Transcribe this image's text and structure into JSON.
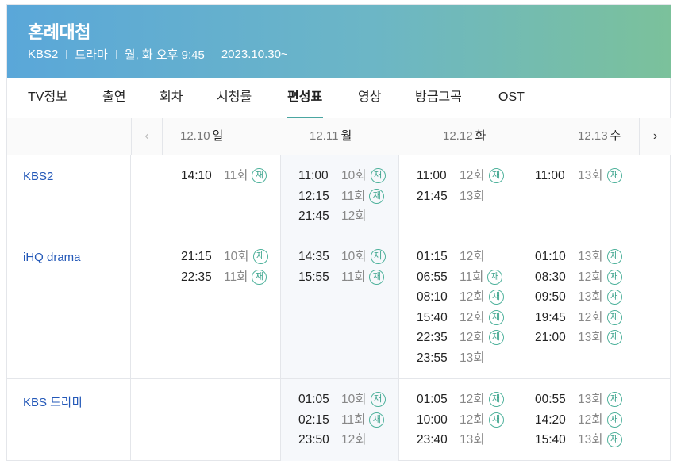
{
  "program": {
    "title": "혼례대첩",
    "channel": "KBS2",
    "genre": "드라마",
    "airtime": "월, 화 오후 9:45",
    "start_date": "2023.10.30~"
  },
  "tabs": [
    "TV정보",
    "출연",
    "회차",
    "시청률",
    "편성표",
    "영상",
    "방금그곡",
    "OST"
  ],
  "active_tab": "편성표",
  "nav": {
    "prev_icon": "‹",
    "next_icon": "›"
  },
  "days": [
    {
      "date": "12.10",
      "weekday": "일"
    },
    {
      "date": "12.11",
      "weekday": "월"
    },
    {
      "date": "12.12",
      "weekday": "화"
    },
    {
      "date": "12.13",
      "weekday": "수"
    }
  ],
  "rerun_mark": "재",
  "schedule": [
    {
      "channel": "KBS2",
      "days": [
        [
          {
            "time": "14:10",
            "episode": "11회",
            "rerun": true
          }
        ],
        [
          {
            "time": "11:00",
            "episode": "10회",
            "rerun": true
          },
          {
            "time": "12:15",
            "episode": "11회",
            "rerun": true
          },
          {
            "time": "21:45",
            "episode": "12회",
            "rerun": false
          }
        ],
        [
          {
            "time": "11:00",
            "episode": "12회",
            "rerun": true
          },
          {
            "time": "21:45",
            "episode": "13회",
            "rerun": false
          }
        ],
        [
          {
            "time": "11:00",
            "episode": "13회",
            "rerun": true
          }
        ]
      ]
    },
    {
      "channel": "iHQ drama",
      "days": [
        [
          {
            "time": "21:15",
            "episode": "10회",
            "rerun": true
          },
          {
            "time": "22:35",
            "episode": "11회",
            "rerun": true
          }
        ],
        [
          {
            "time": "14:35",
            "episode": "10회",
            "rerun": true
          },
          {
            "time": "15:55",
            "episode": "11회",
            "rerun": true
          }
        ],
        [
          {
            "time": "01:15",
            "episode": "12회",
            "rerun": false
          },
          {
            "time": "06:55",
            "episode": "11회",
            "rerun": true
          },
          {
            "time": "08:10",
            "episode": "12회",
            "rerun": true
          },
          {
            "time": "15:40",
            "episode": "12회",
            "rerun": true
          },
          {
            "time": "22:35",
            "episode": "12회",
            "rerun": true
          },
          {
            "time": "23:55",
            "episode": "13회",
            "rerun": false
          }
        ],
        [
          {
            "time": "01:10",
            "episode": "13회",
            "rerun": true
          },
          {
            "time": "08:30",
            "episode": "12회",
            "rerun": true
          },
          {
            "time": "09:50",
            "episode": "13회",
            "rerun": true
          },
          {
            "time": "19:45",
            "episode": "12회",
            "rerun": true
          },
          {
            "time": "21:00",
            "episode": "13회",
            "rerun": true
          }
        ]
      ]
    },
    {
      "channel": "KBS 드라마",
      "days": [
        [],
        [
          {
            "time": "01:05",
            "episode": "10회",
            "rerun": true
          },
          {
            "time": "02:15",
            "episode": "11회",
            "rerun": true
          },
          {
            "time": "23:50",
            "episode": "12회",
            "rerun": false
          }
        ],
        [
          {
            "time": "01:05",
            "episode": "12회",
            "rerun": true
          },
          {
            "time": "10:00",
            "episode": "12회",
            "rerun": true
          },
          {
            "time": "23:40",
            "episode": "13회",
            "rerun": false
          }
        ],
        [
          {
            "time": "00:55",
            "episode": "13회",
            "rerun": true
          },
          {
            "time": "14:20",
            "episode": "12회",
            "rerun": true
          },
          {
            "time": "15:40",
            "episode": "13회",
            "rerun": true
          }
        ]
      ]
    }
  ]
}
